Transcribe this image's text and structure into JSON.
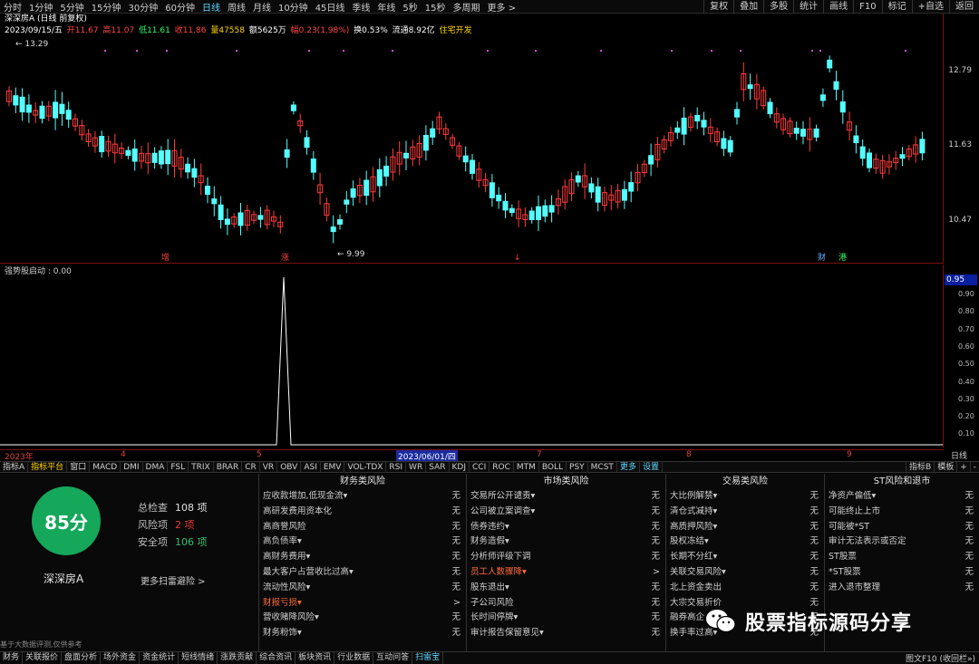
{
  "topbar": {
    "timeframes": [
      "分时",
      "1分钟",
      "5分钟",
      "15分钟",
      "30分钟",
      "60分钟",
      "日线",
      "周线",
      "月线",
      "10分钟",
      "45日线",
      "季线",
      "年线",
      "5秒",
      "15秒",
      "多周期",
      "更多 >"
    ],
    "active_index": 6,
    "right_buttons": [
      "复权",
      "叠加",
      "多股",
      "统计",
      "画线",
      "F10",
      "标记",
      "+自选",
      "返回"
    ]
  },
  "info": {
    "stock": "深深房A (日线 前复权)",
    "date": "2023/09/15/五",
    "open": "开11.67",
    "high": "高11.07",
    "low": "低11.61",
    "close": "收11.86",
    "volume": "量47558",
    "amount": "额5625万",
    "change": "幅0.23(1.98%)",
    "turnover": "换0.53%",
    "float": "流通8.92亿",
    "sector": "住宅开发",
    "max_label": "13.29",
    "min_label": "9.99"
  },
  "axis": {
    "price_labels": [
      "12.79",
      "11.63",
      "10.47"
    ],
    "sub_labels": [
      "0.90",
      "0.80",
      "0.70",
      "0.60",
      "0.50",
      "0.40",
      "0.30",
      "0.20",
      "0.10"
    ],
    "marker": "0.95"
  },
  "signals": [
    "增",
    "涨",
    "↓",
    "财",
    "港"
  ],
  "subchart": {
    "title": "强势股启动 : 0.00"
  },
  "datebar": {
    "labels": [
      "2023年",
      "4",
      "5",
      "2023/06/01/四",
      "7",
      "8",
      "9"
    ],
    "period": "日线"
  },
  "indicators": {
    "items": [
      "指标A",
      "指标平台",
      "窗口",
      "MACD",
      "DMI",
      "DMA",
      "FSL",
      "TRIX",
      "BRAR",
      "CR",
      "VR",
      "OBV",
      "ASI",
      "EMV",
      "VOL-TDX",
      "RSI",
      "WR",
      "SAR",
      "KDJ",
      "CCI",
      "ROC",
      "MTM",
      "BOLL",
      "PSY",
      "MCST",
      "更多",
      "设置"
    ],
    "right": [
      "指标B",
      "模板",
      "+",
      "-"
    ]
  },
  "summary": {
    "score": "85分",
    "name": "深深房A",
    "total_label": "总检查",
    "total_value": "108 项",
    "risk_label": "风险项",
    "risk_value": "2 项",
    "safe_label": "安全项",
    "safe_value": "106 项",
    "more": "更多扫雷避险 >"
  },
  "columns": [
    {
      "title": "财务类风险",
      "rows": [
        {
          "label": "应收款增加,低现金流▾",
          "value": "无",
          "warn": false
        },
        {
          "label": "高研发费用资本化",
          "value": "无",
          "warn": false
        },
        {
          "label": "高商誉风险",
          "value": "无",
          "warn": false
        },
        {
          "label": "高负债率▾",
          "value": "无",
          "warn": false
        },
        {
          "label": "高财务费用▾",
          "value": "无",
          "warn": false
        },
        {
          "label": "最大客户占营收比过高▾",
          "value": "无",
          "warn": false
        },
        {
          "label": "流动性风险▾",
          "value": "无",
          "warn": false
        },
        {
          "label": "财报亏损▾",
          "value": ">",
          "warn": true
        },
        {
          "label": "营收赌降风险▾",
          "value": "无",
          "warn": false
        },
        {
          "label": "财务粉饰▾",
          "value": "无",
          "warn": false
        }
      ]
    },
    {
      "title": "市场类风险",
      "rows": [
        {
          "label": "交易所公开谴责▾",
          "value": "无",
          "warn": false
        },
        {
          "label": "公司被立案调查▾",
          "value": "无",
          "warn": false
        },
        {
          "label": "债券违约▾",
          "value": "无",
          "warn": false
        },
        {
          "label": "财务造假▾",
          "value": "无",
          "warn": false
        },
        {
          "label": "分析师评级下调",
          "value": "无",
          "warn": false
        },
        {
          "label": "员工人数骤降▾",
          "value": ">",
          "warn": true
        },
        {
          "label": "股东退出▾",
          "value": "无",
          "warn": false
        },
        {
          "label": "子公司风险",
          "value": "无",
          "warn": false
        },
        {
          "label": "长时间停牌▾",
          "value": "无",
          "warn": false
        },
        {
          "label": "审计报告保留意见▾",
          "value": "无",
          "warn": false
        }
      ]
    },
    {
      "title": "交易类风险",
      "rows": [
        {
          "label": "大比例解禁▾",
          "value": "无",
          "warn": false
        },
        {
          "label": "清仓式减持▾",
          "value": "无",
          "warn": false
        },
        {
          "label": "高质押风险▾",
          "value": "无",
          "warn": false
        },
        {
          "label": "股权冻结▾",
          "value": "无",
          "warn": false
        },
        {
          "label": "长期不分红▾",
          "value": "无",
          "warn": false
        },
        {
          "label": "关联交易风险▾",
          "value": "无",
          "warn": false
        },
        {
          "label": "北上资金卖出",
          "value": "无",
          "warn": false
        },
        {
          "label": "大宗交易折价",
          "value": "无",
          "warn": false
        },
        {
          "label": "融券高企",
          "value": "无",
          "warn": false
        },
        {
          "label": "换手率过高▾",
          "value": "无",
          "warn": false
        }
      ]
    },
    {
      "title": "ST风险和退市",
      "rows": [
        {
          "label": "净资产偏低▾",
          "value": "无",
          "warn": false
        },
        {
          "label": "可能终止上市",
          "value": "无",
          "warn": false
        },
        {
          "label": "可能被*ST",
          "value": "无",
          "warn": false
        },
        {
          "label": "审计无法表示或否定",
          "value": "无",
          "warn": false
        },
        {
          "label": "ST股票",
          "value": "无",
          "warn": false
        },
        {
          "label": "*ST股票",
          "value": "无",
          "warn": false
        },
        {
          "label": "进入退市整理",
          "value": "无",
          "warn": false
        },
        {
          "label": "",
          "value": "",
          "warn": false
        },
        {
          "label": "",
          "value": "",
          "warn": false
        },
        {
          "label": "",
          "value": "",
          "warn": false
        }
      ]
    }
  ],
  "watermark": "股票指标源码分享",
  "note": "基于大数据评测,仅供参考",
  "bottombar": {
    "items": [
      "财务",
      "关联报价",
      "盘面分析",
      "场外资金",
      "资金统计",
      "短线情绪",
      "涨跌贡献",
      "综合资讯",
      "板块资讯",
      "行业数据",
      "互动问答",
      "扫雷宝"
    ],
    "selected": 11,
    "right": "图文F10 (收回栏»)"
  },
  "colors": {
    "up": "#ff3b3b",
    "down": "#54ffff",
    "ma": "#ffffff"
  }
}
